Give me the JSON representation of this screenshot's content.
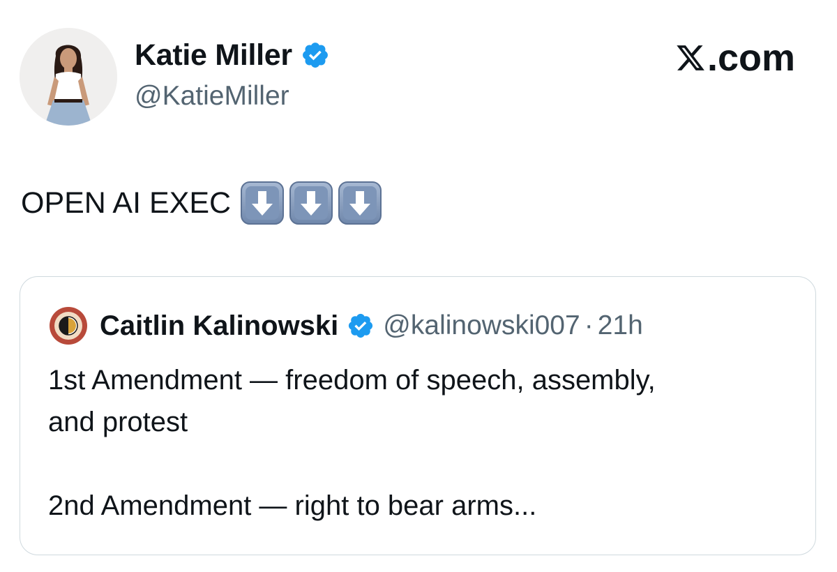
{
  "post": {
    "author": {
      "name": "Katie Miller",
      "handle": "@KatieMiller",
      "verified": true,
      "avatar_icon": "profile-photo"
    },
    "site_label": ".com",
    "site_logo_icon": "x-logo-icon",
    "text": "OPEN AI EXEC",
    "emojis": [
      "down-arrow-emoji",
      "down-arrow-emoji",
      "down-arrow-emoji"
    ]
  },
  "quote": {
    "author": {
      "name": "Caitlin Kalinowski",
      "handle": "@kalinowski007",
      "verified": true,
      "avatar_icon": "half-circle-logo"
    },
    "separator": "·",
    "time": "21h",
    "lines": [
      "1st Amendment — freedom of speech, assembly,",
      "and protest",
      "2nd Amendment — right to bear arms..."
    ]
  },
  "colors": {
    "text_primary": "#0f1419",
    "text_secondary": "#536471",
    "verified_blue": "#1d9bf0",
    "card_border": "#cfd9de",
    "emoji_key": "#7d95b8"
  }
}
